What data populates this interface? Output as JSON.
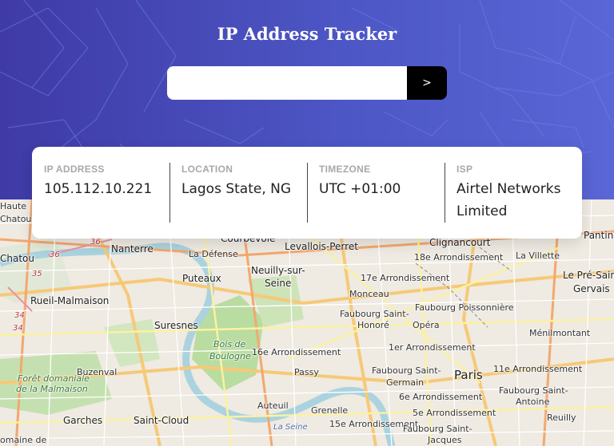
{
  "header": {
    "title": "IP Address Tracker"
  },
  "search": {
    "value": "",
    "placeholder": "",
    "submit_label": ">"
  },
  "info": [
    {
      "label": "IP ADDRESS",
      "value": "105.112.10.221"
    },
    {
      "label": "LOCATION",
      "value": "Lagos State, NG"
    },
    {
      "label": "TIMEZONE",
      "value": "UTC +01:00"
    },
    {
      "label": "ISP",
      "value": "Airtel Networks Limited"
    }
  ],
  "map": {
    "labels": {
      "haute": "Haute",
      "chatou_top": "Chatou",
      "courbevoie": "Courbevoie",
      "clignancourt": "Clignancourt",
      "pantin": "Pantin",
      "chatou": "Chatou",
      "nanterre": "Nanterre",
      "la_defense": "La Défense",
      "levallois": "Levallois-Perret",
      "arr18": "18e Arrondissement",
      "la_villette": "La Villette",
      "le_pre": "Le Pré-Saint-",
      "gervais": "Gervais",
      "puteaux": "Puteaux",
      "neuilly": "Neuilly-sur-",
      "seine": "Seine",
      "arr17": "17e Arrondissement",
      "rueil": "Rueil-Malmaison",
      "monceau": "Monceau",
      "poissonniere": "Faubourg Poissonnière",
      "faubourg_st": "Faubourg Saint-",
      "honore": "Honoré",
      "opera": "Opéra",
      "suresnes": "Suresnes",
      "menilmontant": "Ménilmontant",
      "bois": "Bois de",
      "boulogne": "Boulogne",
      "arr16": "16e Arrondissement",
      "arr1": "1er Arrondissement",
      "foret": "Forêt domaniale",
      "malmaison": "de la Malmaison",
      "buzenval": "Buzenval",
      "passy": "Passy",
      "paris": "Paris",
      "arr11": "11e Arrondissement",
      "fbg_st_germain": "Faubourg Saint-",
      "germain": "Germain",
      "fbg_st_antoine": "Faubourg Saint-",
      "antoine": "Antoine",
      "arr6": "6e Arrondissement",
      "garches": "Garches",
      "saint_cloud": "Saint-Cloud",
      "auteuil": "Auteuil",
      "grenelle": "Grenelle",
      "arr15": "15e Arrondissement",
      "arr5": "5e Arrondissement",
      "reuilly": "Reuilly",
      "la_seine": "La Seine",
      "domaine": "omaine de",
      "fbg_st_jacques": "Faubourg Saint-",
      "jacques": "Jacques",
      "r36": "36",
      "r36b": "36",
      "r35": "35",
      "r34": "34",
      "r34b": "34"
    }
  }
}
